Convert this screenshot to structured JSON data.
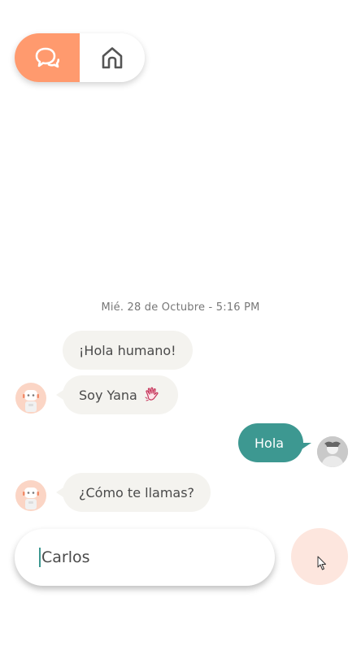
{
  "toggle": {
    "active_icon": "chat-bubbles-icon",
    "inactive_icon": "home-icon",
    "active_color": "#ff9a6e"
  },
  "chat": {
    "timestamp": "Mié. 28 de Octubre - 5:16 PM",
    "messages": [
      {
        "sender": "bot",
        "text": "¡Hola humano!"
      },
      {
        "sender": "bot",
        "text": "Soy Yana",
        "emoji": "waving-hand-icon"
      },
      {
        "sender": "user",
        "text": "Hola"
      },
      {
        "sender": "bot",
        "text": "¿Cómo te llamas?"
      }
    ],
    "bot_bubble_color": "#f4f3ef",
    "user_bubble_color": "#3d9891"
  },
  "composer": {
    "value": "Carlos",
    "send_button_color": "#fde6de"
  }
}
